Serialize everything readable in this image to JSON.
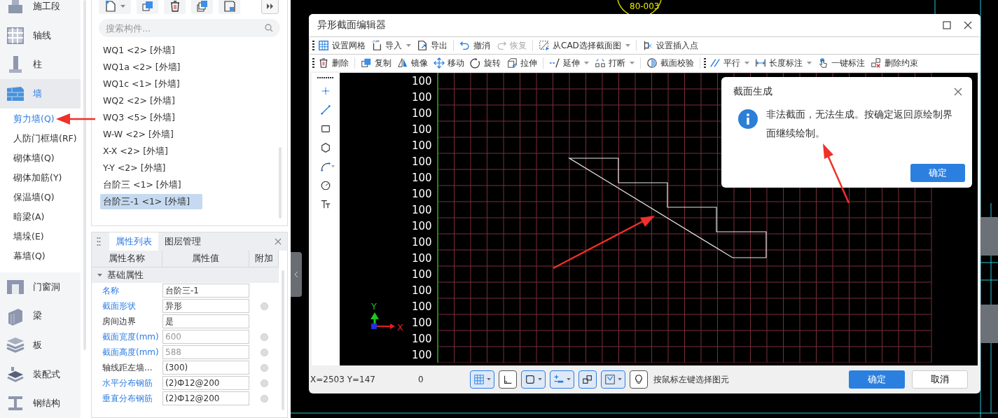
{
  "sidebar": {
    "items": [
      {
        "label": "施工段",
        "selected": false
      },
      {
        "label": "轴线",
        "selected": false
      },
      {
        "label": "柱",
        "selected": false
      },
      {
        "label": "墙",
        "selected": true,
        "expanded": true,
        "children": [
          {
            "label": "剪力墙(Q)",
            "selected": true
          },
          {
            "label": "人防门框墙(RF)",
            "selected": false
          },
          {
            "label": "砌体墙(Q)",
            "selected": false
          },
          {
            "label": "砌体加筋(Y)",
            "selected": false
          },
          {
            "label": "保温墙(Q)",
            "selected": false
          },
          {
            "label": "暗梁(A)",
            "selected": false
          },
          {
            "label": "墙垛(E)",
            "selected": false
          },
          {
            "label": "幕墙(Q)",
            "selected": false
          }
        ]
      },
      {
        "label": "门窗洞",
        "selected": false
      },
      {
        "label": "梁",
        "selected": false
      },
      {
        "label": "板",
        "selected": false
      },
      {
        "label": "装配式",
        "selected": false
      },
      {
        "label": "钢结构",
        "selected": false
      }
    ]
  },
  "components": {
    "search": {
      "placeholder": "搜索构件..."
    },
    "items": [
      {
        "label": "WQ1 <2> [外墙]",
        "selected": false
      },
      {
        "label": "WQ1a <2> [外墙]",
        "selected": false
      },
      {
        "label": "WQ1c <1> [外墙]",
        "selected": false
      },
      {
        "label": "WQ2 <2> [外墙]",
        "selected": false
      },
      {
        "label": "WQ3 <5> [外墙]",
        "selected": false
      },
      {
        "label": "W-W <2> [外墙]",
        "selected": false
      },
      {
        "label": "X-X <2> [外墙]",
        "selected": false
      },
      {
        "label": "Y-Y <2> [外墙]",
        "selected": false
      },
      {
        "label": "台阶三 <1> [外墙]",
        "selected": false
      },
      {
        "label": "台阶三-1 <1> [外墙]",
        "selected": true
      }
    ]
  },
  "properties": {
    "tabs": [
      {
        "label": "属性列表",
        "selected": true
      },
      {
        "label": "图层管理",
        "selected": false
      }
    ],
    "columns": [
      "属性名称",
      "属性值",
      "附加"
    ],
    "group": {
      "label": "基础属性",
      "expanded": true
    },
    "rows": [
      {
        "name": "名称",
        "highlighted": true,
        "value": "台阶三-1",
        "disabled": false,
        "attached": false
      },
      {
        "name": "截面形状",
        "highlighted": true,
        "value": "异形",
        "disabled": false,
        "attached": true
      },
      {
        "name": "房间边界",
        "highlighted": false,
        "value": "是",
        "disabled": false,
        "attached": false
      },
      {
        "name": "截面宽度(mm)",
        "highlighted": true,
        "value": "600",
        "disabled": true,
        "attached": true
      },
      {
        "name": "截面高度(mm)",
        "highlighted": true,
        "value": "588",
        "disabled": true,
        "attached": true
      },
      {
        "name": "轴线距左墙...",
        "highlighted": false,
        "value": "(300)",
        "disabled": false,
        "attached": true
      },
      {
        "name": "水平分布钢筋",
        "highlighted": true,
        "value": "(2)Ф12@200",
        "disabled": false,
        "attached": true
      },
      {
        "name": "垂直分布钢筋",
        "highlighted": true,
        "value": "(2)Ф12@200",
        "disabled": false,
        "attached": true
      }
    ]
  },
  "cad_label": "80-003",
  "editor": {
    "title": "异形截面编辑器",
    "toolbars": [
      [
        [
          {
            "label": "设置网格",
            "dropdown": false,
            "disabled": false
          },
          {
            "label": "导入",
            "dropdown": true,
            "disabled": false
          },
          {
            "label": "导出",
            "dropdown": false,
            "disabled": false
          }
        ],
        [
          {
            "label": "撤消",
            "dropdown": false,
            "disabled": false
          },
          {
            "label": "恢复",
            "dropdown": false,
            "disabled": true
          }
        ],
        [
          {
            "label": "从CAD选择截面图",
            "dropdown": true,
            "disabled": false
          }
        ],
        [
          {
            "label": "设置插入点",
            "dropdown": false,
            "disabled": false
          }
        ]
      ],
      [
        [
          {
            "label": "删除",
            "dropdown": false,
            "disabled": false
          }
        ],
        [
          {
            "label": "复制",
            "dropdown": false,
            "disabled": false
          },
          {
            "label": "镜像",
            "dropdown": false,
            "disabled": false
          },
          {
            "label": "移动",
            "dropdown": false,
            "disabled": false
          },
          {
            "label": "旋转",
            "dropdown": false,
            "disabled": false
          },
          {
            "label": "拉伸",
            "dropdown": false,
            "disabled": false
          }
        ],
        [
          {
            "label": "延伸",
            "dropdown": true,
            "disabled": false
          },
          {
            "label": "打断",
            "dropdown": true,
            "disabled": false
          }
        ],
        [
          {
            "label": "截面校验",
            "dropdown": false,
            "disabled": false
          }
        ],
        [
          {
            "label": "平行",
            "dropdown": true,
            "disabled": false
          },
          {
            "label": "长度标注",
            "dropdown": true,
            "disabled": false
          },
          {
            "label": "一键标注",
            "dropdown": false,
            "disabled": false
          },
          {
            "label": "删除约束",
            "dropdown": false,
            "disabled": false
          }
        ]
      ]
    ],
    "tools": [
      {
        "dropdown": false
      },
      {
        "dropdown": false
      },
      {
        "dropdown": false
      },
      {
        "dropdown": false
      },
      {
        "dropdown": true
      },
      {
        "dropdown": false
      },
      {
        "dropdown": false
      }
    ],
    "row_labels": [
      "100",
      "100",
      "100",
      "100",
      "100",
      "100",
      "100",
      "100",
      "100",
      "100",
      "100",
      "100",
      "100",
      "100",
      "100",
      "100",
      "100",
      "100"
    ],
    "axes": {
      "y": "Y",
      "x": "X"
    },
    "status": {
      "coords": "X=2503 Y=147",
      "count": "0",
      "toggles": [
        {
          "selected": true,
          "dropdown": true
        },
        {
          "selected": false,
          "dropdown": false
        },
        {
          "selected": true,
          "dropdown": true
        },
        {
          "selected": true,
          "dropdown": true
        },
        {
          "selected": true,
          "dropdown": false
        },
        {
          "selected": true,
          "dropdown": true
        },
        {
          "selected": false,
          "dropdown": false
        }
      ],
      "hint": "按鼠标左键选择图元",
      "ok": "确定",
      "cancel": "取消"
    }
  },
  "dialog": {
    "title": "截面生成",
    "message": "非法截面，无法生成。按确定返回原绘制界面继续绘制。",
    "ok": "确定"
  }
}
